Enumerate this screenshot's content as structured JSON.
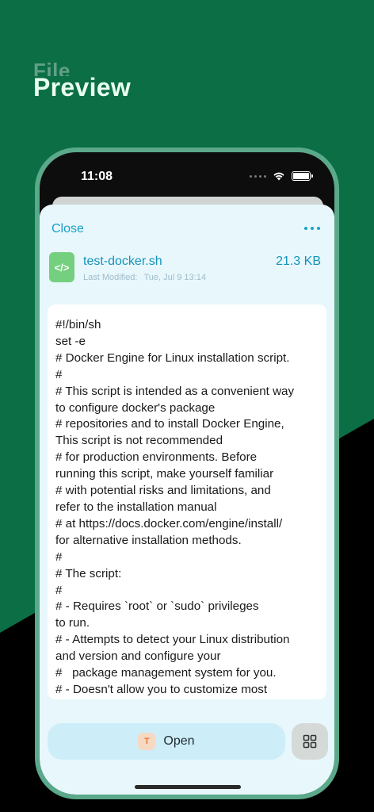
{
  "hero": {
    "faded_text": "File",
    "title": "Preview"
  },
  "status_bar": {
    "time": "11:08"
  },
  "sheet": {
    "close_label": "Close",
    "file": {
      "icon_text": "</>",
      "name": "test-docker.sh",
      "modified_label": "Last Modified:",
      "modified_date": "Tue, Jul 9 13:14",
      "size": "21.3 KB"
    },
    "content_lines": [
      "#!/bin/sh",
      "set -e",
      "# Docker Engine for Linux installation script.",
      "#",
      "# This script is intended as a convenient way",
      "to configure docker's package",
      "# repositories and to install Docker Engine,",
      "This script is not recommended",
      "# for production environments. Before",
      "running this script, make yourself familiar",
      "# with potential risks and limitations, and",
      "refer to the installation manual",
      "# at https://docs.docker.com/engine/install/",
      "for alternative installation methods.",
      "#",
      "# The script:",
      "#",
      "# - Requires `root` or `sudo` privileges",
      "to run.",
      "# - Attempts to detect your Linux distribution",
      "and version and configure your",
      "#   package management system for you.",
      "# - Doesn't allow you to customize most"
    ],
    "open_button": {
      "icon_text": "T",
      "label": "Open"
    }
  },
  "colors": {
    "background_green": "#0b6e45",
    "accent_blue": "#1aa0c8",
    "sheet_bg": "#e8f7fb",
    "file_icon_green": "#74d07f"
  }
}
